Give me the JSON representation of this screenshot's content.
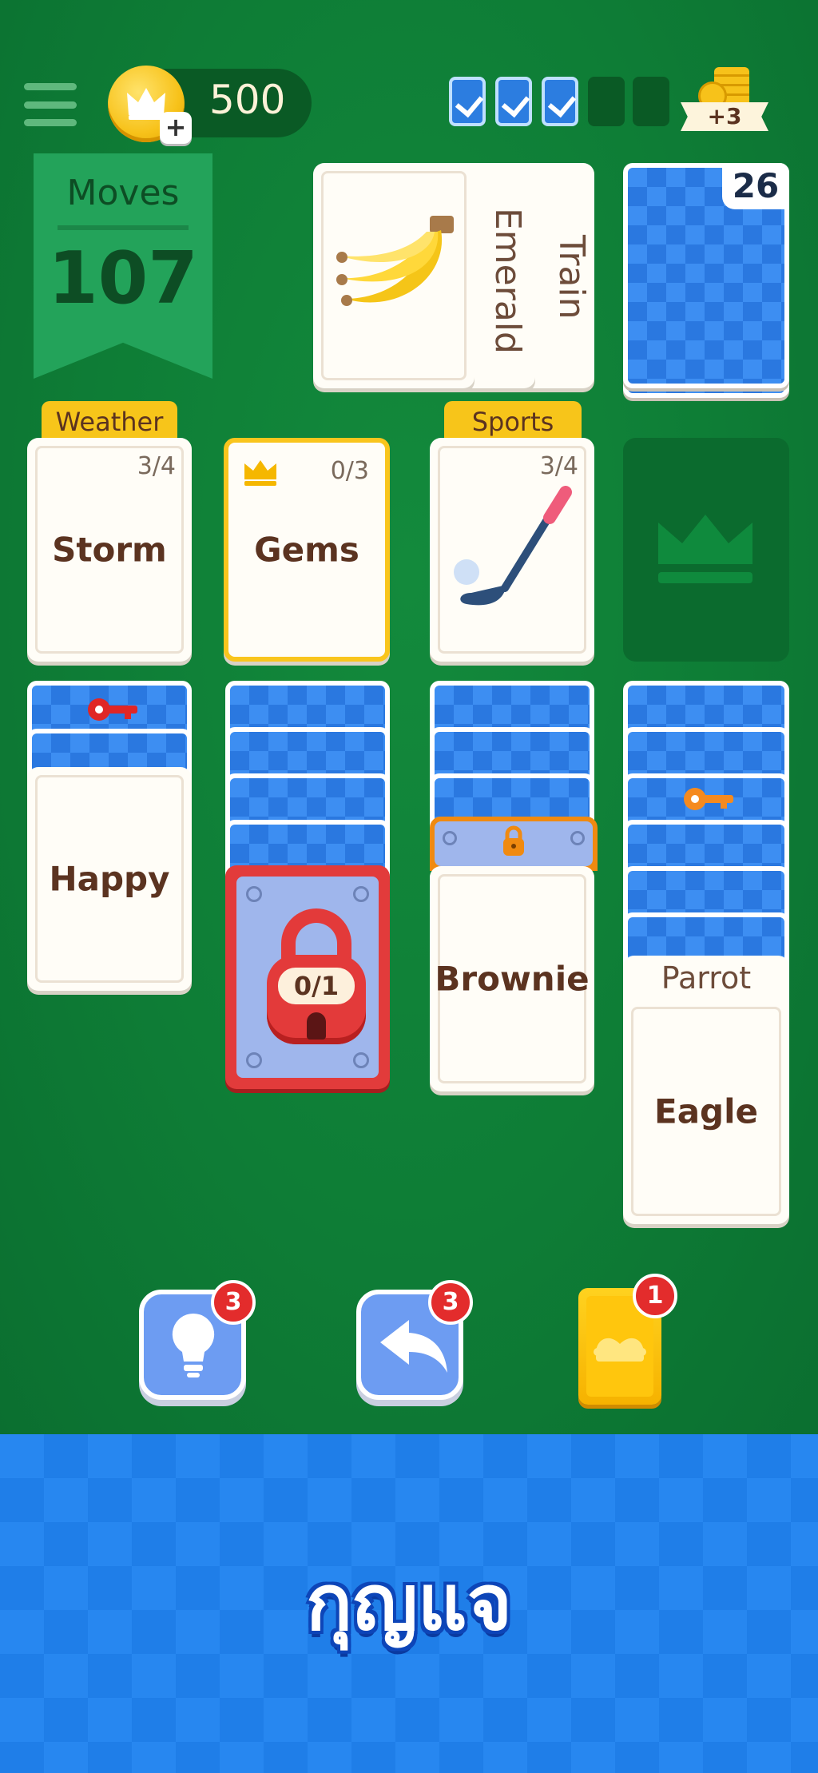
{
  "header": {
    "coins": "500",
    "coin_plus": "+",
    "progress_checks": [
      true,
      true,
      true,
      false,
      false
    ],
    "reward": "+3"
  },
  "moves": {
    "label": "Moves",
    "value": "107"
  },
  "stock": {
    "count": "26"
  },
  "waste": {
    "top_card": "banana",
    "fanned_cards": [
      "Emerald",
      "Train"
    ]
  },
  "foundations": [
    {
      "tag": "Weather",
      "word": "Storm",
      "count": "3/4"
    },
    {
      "tag": "",
      "word": "Gems",
      "count": "0/3",
      "category_icon": "crown-icon"
    },
    {
      "tag": "Sports",
      "word": "",
      "count": "3/4",
      "image": "golf-club"
    },
    {
      "tag": "",
      "word": "",
      "empty_icon": "crown-icon"
    }
  ],
  "tableau": {
    "col1": {
      "top": "Happy",
      "key_on_back": "red-key"
    },
    "col2": {
      "lock_label": "0/1"
    },
    "col3": {
      "top": "Brownie",
      "locked": true
    },
    "col4": {
      "peek": "Parrot",
      "top": "Eagle",
      "key_on_back": "orange-key"
    }
  },
  "actions": {
    "hint": {
      "badge": "3"
    },
    "undo": {
      "badge": "3"
    },
    "joker": {
      "badge": "1"
    }
  },
  "bottom_banner": {
    "text": "กุญแจ"
  },
  "colors": {
    "felt": "#0e7d36",
    "card_back": "#3d8ef2",
    "tag": "#f7c51a",
    "lock_red": "#e23b3b"
  }
}
